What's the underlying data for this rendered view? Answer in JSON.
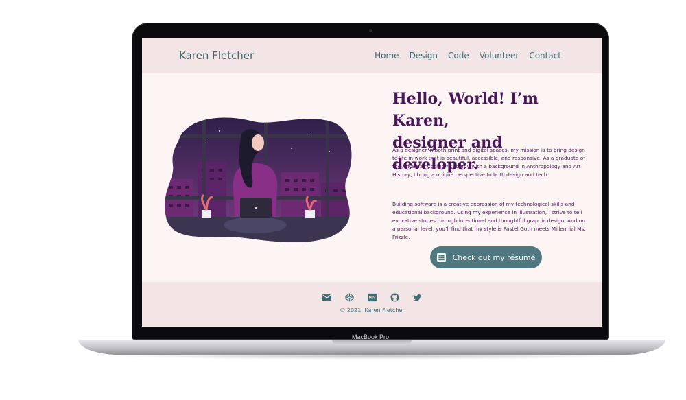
{
  "site": {
    "brand": "Karen Fletcher",
    "nav": [
      "Home",
      "Design",
      "Code",
      "Volunteer",
      "Contact"
    ]
  },
  "hero": {
    "headline_line1": "Hello, World! I’m Karen,",
    "headline_line2": "designer and developer.",
    "paragraph1": "As a designer in both print and digital spaces, my mission is to bring design to life in work that is beautiful, accessible, and responsive. As a graduate of the Arkansas Coding Academy with a background in Anthropology and Art History, I bring a unique perspective to both design and tech.",
    "paragraph2": "Building software is a creative expression of my technological skills and educational background. Using my experience in illustration, I strive to tell evocative stories through intentional and thoughtful graphic design. And on a personal level, you’ll find that my style is Pastel Goth meets Millennial Ms. Frizzle.",
    "resume_button": "Check out my résumé"
  },
  "footer": {
    "icons": [
      "mail-icon",
      "codepen-icon",
      "dev-icon",
      "github-icon",
      "twitter-icon"
    ],
    "dev_badge": "DEV",
    "copyright": "© 2021, Karen Fletcher"
  },
  "device": {
    "label": "MacBook Pro"
  },
  "colors": {
    "nav_bg": "#f3e4e5",
    "page_bg": "#fdf5f4",
    "teal": "#3f6b73",
    "button": "#4f7780",
    "headline": "#4a1659",
    "illustration_purple": "#5a2a6e"
  }
}
